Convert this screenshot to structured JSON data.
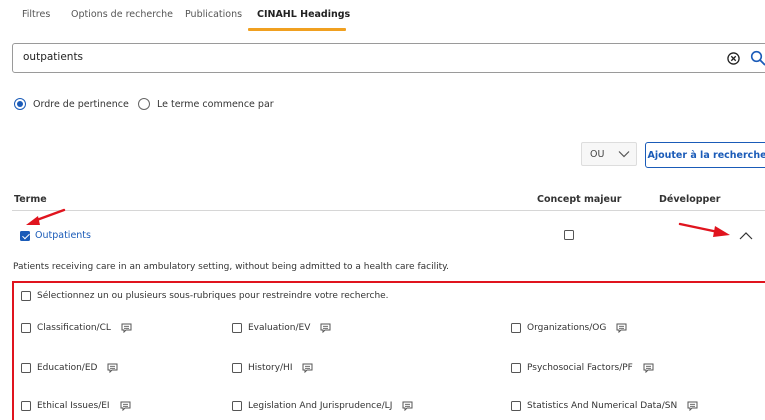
{
  "tabs": [
    {
      "label": "Filtres"
    },
    {
      "label": "Options de recherche"
    },
    {
      "label": "Publications"
    },
    {
      "label": "CINAHL Headings"
    }
  ],
  "search": {
    "value": "outpatients",
    "clear_icon": "clear-circle-icon",
    "search_icon": "search-icon"
  },
  "options": {
    "relevance_label": "Ordre de pertinence",
    "starts_with_label": "Le terme commence par",
    "selected": "relevance"
  },
  "operator": {
    "value": "OU",
    "icon": "chevron-down-icon"
  },
  "add_button": "Ajouter à la recherche",
  "table": {
    "headers": {
      "term": "Terme",
      "major": "Concept majeur",
      "expand": "Développer"
    },
    "term": {
      "label": "Outpatients",
      "checked": true,
      "major_checked": false,
      "expanded": true
    },
    "description": "Patients receiving care in an ambulatory setting, without being admitted to a health care facility."
  },
  "subheadings": {
    "select_all": "Sélectionnez un ou plusieurs sous-rubriques pour restreindre votre recherche.",
    "items": [
      {
        "label": "Classification/CL"
      },
      {
        "label": "Evaluation/EV"
      },
      {
        "label": "Organizations/OG"
      },
      {
        "label": "Education/ED"
      },
      {
        "label": "History/HI"
      },
      {
        "label": "Psychosocial Factors/PF"
      },
      {
        "label": "Ethical Issues/EI"
      },
      {
        "label": "Legislation And Jurisprudence/LJ"
      },
      {
        "label": "Statistics And Numerical Data/SN"
      }
    ]
  },
  "colors": {
    "accent": "#1a5bb8",
    "active_tab_underline": "#f0a020",
    "annotation_red": "#e0141e"
  }
}
